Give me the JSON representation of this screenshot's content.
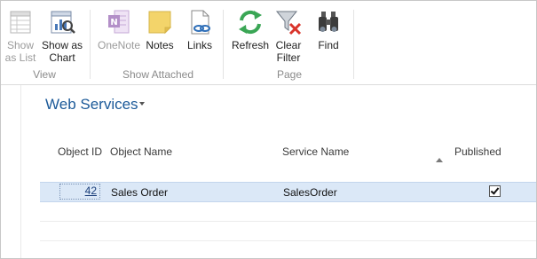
{
  "ribbon": {
    "groups": [
      {
        "label": "View"
      },
      {
        "label": "Show Attached"
      },
      {
        "label": "Page"
      }
    ],
    "buttons": {
      "show_as_list": {
        "line1": "Show",
        "line2": "as List",
        "icon": "list-view-icon",
        "enabled": false
      },
      "show_as_chart": {
        "line1": "Show as",
        "line2": "Chart",
        "icon": "chart-view-icon",
        "enabled": true
      },
      "onenote": {
        "label": "OneNote",
        "icon": "onenote-icon",
        "enabled": false
      },
      "notes": {
        "label": "Notes",
        "icon": "note-icon",
        "enabled": true
      },
      "links": {
        "label": "Links",
        "icon": "link-document-icon",
        "enabled": true
      },
      "refresh": {
        "label": "Refresh",
        "icon": "refresh-icon",
        "enabled": true
      },
      "clear_filter": {
        "line1": "Clear",
        "line2": "Filter",
        "icon": "clear-filter-icon",
        "enabled": true
      },
      "find": {
        "label": "Find",
        "icon": "binoculars-icon",
        "enabled": true
      }
    }
  },
  "page": {
    "title": "Web Services"
  },
  "table": {
    "columns": [
      "Object ID",
      "Object Name",
      "Service Name",
      "Published"
    ],
    "sorted_column": "Service Name",
    "sort_direction": "ascending",
    "rows": [
      {
        "object_id": "42",
        "object_name": "Sales Order",
        "service_name": "SalesOrder",
        "published": true
      }
    ]
  },
  "colors": {
    "title": "#1c5a99",
    "selected_row": "#dbe8f7",
    "refresh_green": "#3aa655",
    "filter_red": "#d9342b",
    "onenote_purple": "#b38fc8",
    "notes_yellow": "#f3d46a"
  }
}
